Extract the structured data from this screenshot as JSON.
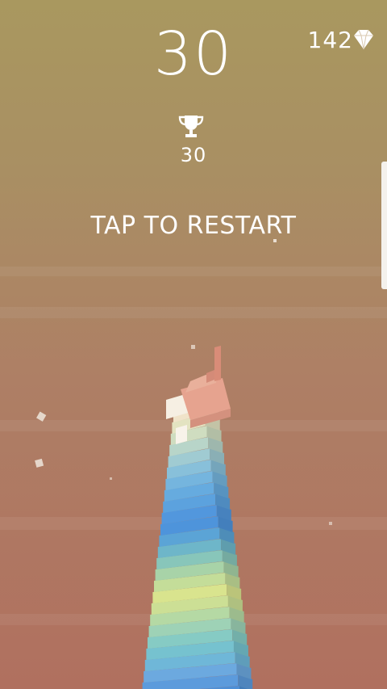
{
  "hud": {
    "score": "30",
    "gems": "142",
    "best_score": "30",
    "restart_prompt": "TAP TO RESTART",
    "gem_icon": "diamond-icon",
    "trophy_icon": "trophy-icon"
  },
  "colors": {
    "text": "#FFFFFF",
    "background_top": "#A9985F",
    "background_bottom": "#B0705F"
  }
}
